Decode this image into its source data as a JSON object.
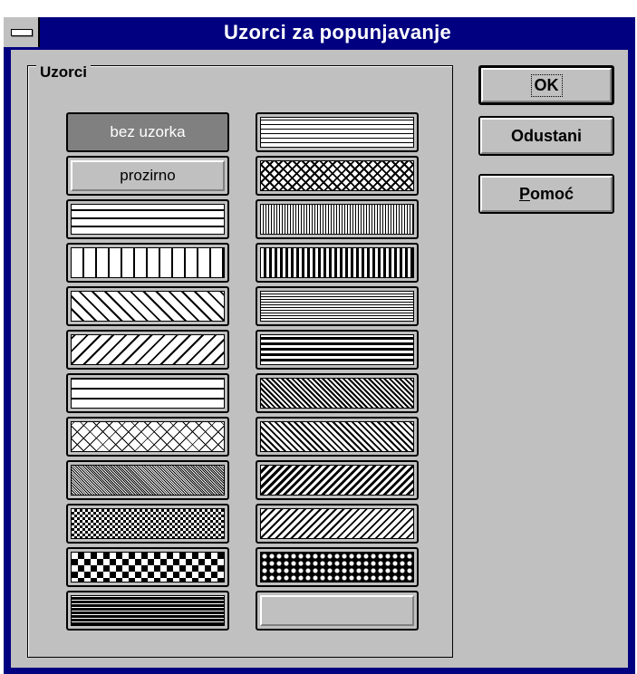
{
  "window": {
    "title": "Uzorci za popunjavanje"
  },
  "group": {
    "label": "Uzorci"
  },
  "patterns_left": [
    {
      "id": "none",
      "label": "bez uzorka",
      "selected": true
    },
    {
      "id": "transparent",
      "label": "prozirno"
    },
    {
      "id": "horizontal-lines"
    },
    {
      "id": "vertical-lines"
    },
    {
      "id": "diagonal-lines-down"
    },
    {
      "id": "diagonal-lines-up"
    },
    {
      "id": "grid"
    },
    {
      "id": "diagonal-cross"
    },
    {
      "id": "fine-dots-gray"
    },
    {
      "id": "fine-checker"
    },
    {
      "id": "large-checker"
    },
    {
      "id": "dense-grid-black"
    }
  ],
  "patterns_right": [
    {
      "id": "fine-grid"
    },
    {
      "id": "dense-diagonal-cross"
    },
    {
      "id": "dense-vertical-lines"
    },
    {
      "id": "bold-vertical-lines"
    },
    {
      "id": "dense-horizontal-lines"
    },
    {
      "id": "bold-horizontal-lines"
    },
    {
      "id": "dense-diagonal-down"
    },
    {
      "id": "medium-diagonal-down"
    },
    {
      "id": "bold-diagonal-up"
    },
    {
      "id": "medium-diagonal-up"
    },
    {
      "id": "lattice"
    },
    {
      "id": "blank"
    }
  ],
  "buttons": {
    "ok": "OK",
    "cancel": "Odustani",
    "help_first": "P",
    "help_rest": "omoć"
  },
  "colors": {
    "titlebar": "#000080",
    "face": "#c0c0c0",
    "shadow": "#808080"
  }
}
